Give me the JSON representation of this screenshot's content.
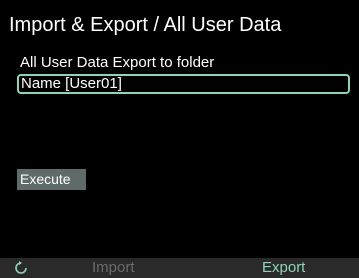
{
  "header": {
    "title": "Import & Export / All User Data"
  },
  "main": {
    "subtitle": "All User Data Export to folder",
    "name_field_value": "Name [User01]",
    "execute_label": "Execute"
  },
  "footer": {
    "back_icon": "refresh-back-icon",
    "import_label": "Import",
    "export_label": "Export"
  },
  "colors": {
    "background": "#000000",
    "accent": "#8fd4b7",
    "button_bg": "#5f6b6b",
    "footer_bg": "#2a2a2a",
    "disabled_text": "#6b6b6b"
  }
}
